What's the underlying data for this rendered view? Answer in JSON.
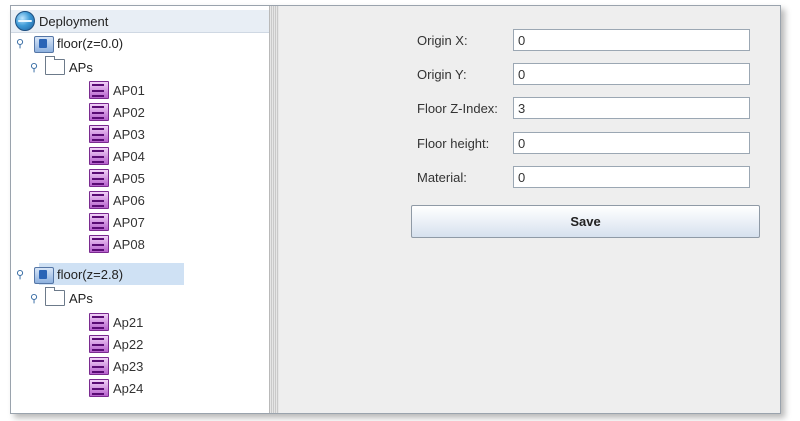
{
  "tree": {
    "root": {
      "label": "Deployment",
      "icon": "globe-icon"
    },
    "floors": [
      {
        "label": "floor(z=0.0)",
        "selected": false,
        "group": {
          "label": "APs"
        },
        "aps": [
          "AP01",
          "AP02",
          "AP03",
          "AP04",
          "AP05",
          "AP06",
          "AP07",
          "AP08"
        ]
      },
      {
        "label": "floor(z=2.8)",
        "selected": true,
        "group": {
          "label": "APs"
        },
        "aps": [
          "Ap21",
          "Ap22",
          "Ap23",
          "Ap24"
        ]
      }
    ]
  },
  "form": {
    "origin_x": {
      "label": "Origin X:",
      "value": "0"
    },
    "origin_y": {
      "label": "Origin Y:",
      "value": "0"
    },
    "floor_z_index": {
      "label": "Floor Z-Index:",
      "value": "3"
    },
    "floor_height": {
      "label": "Floor height:",
      "value": "0"
    },
    "material": {
      "label": "Material:",
      "value": "0"
    },
    "save_label": "Save"
  },
  "colors": {
    "selection": "#cfe1f4",
    "panel_bg": "#eeeeee",
    "ap_icon": "#b660cc"
  }
}
